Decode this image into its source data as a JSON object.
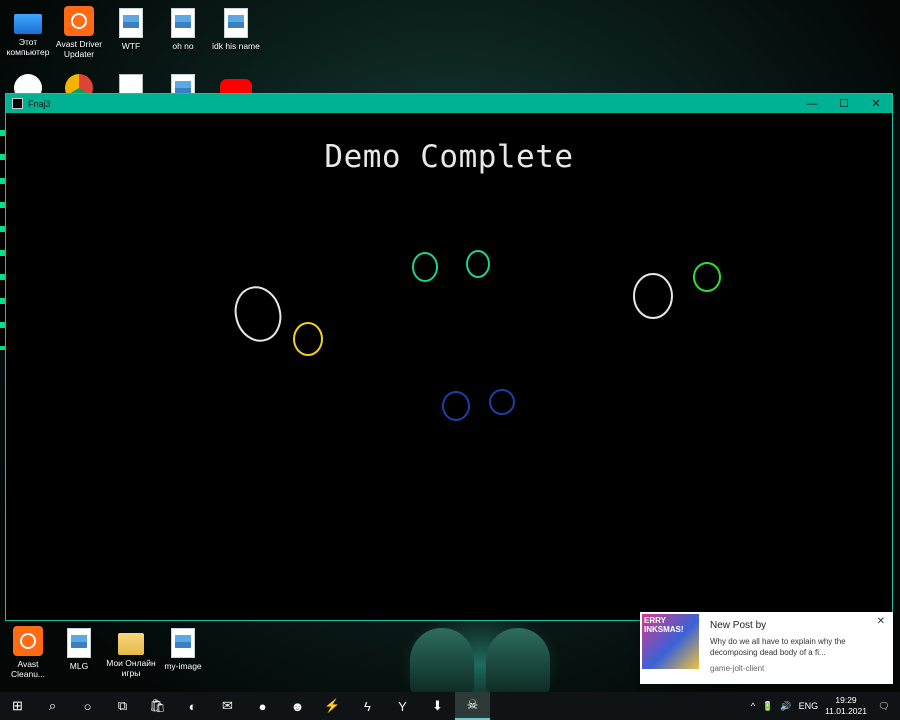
{
  "desktop": {
    "top_icons": [
      {
        "label": "Этот компьютер",
        "icon": "pc"
      },
      {
        "label": "Avast Driver Updater",
        "icon": "avast"
      },
      {
        "label": "WTF",
        "icon": "file"
      },
      {
        "label": "oh no",
        "icon": "file"
      },
      {
        "label": "idk his name",
        "icon": "file"
      }
    ],
    "bottom_icons": [
      {
        "label": "Avast Cleanu...",
        "icon": "avast"
      },
      {
        "label": "MLG",
        "icon": "file"
      },
      {
        "label": "Мои Онлайн игры",
        "icon": "folder"
      },
      {
        "label": "my-image",
        "icon": "file"
      }
    ]
  },
  "window": {
    "title": "Fnaj3",
    "minimize": "—",
    "maximize": "☐",
    "close": "✕",
    "content_title": "Demo Complete",
    "eye_colors": {
      "white": "#e6e6e6",
      "yellow": "#f2d21b",
      "teal": "#1fd18e",
      "green": "#2fe02f",
      "blue": "#1e3ea8"
    }
  },
  "toast": {
    "thumb_text": "ERRY INKSMAS!",
    "title": "New Post by",
    "body": "Why do we all have to explain why the decomposing dead body of a fi...",
    "source": "game-jolt-client",
    "close": "✕"
  },
  "taskbar": {
    "start": "⊞",
    "search": "⌕",
    "cortana": "○",
    "task_view": "⧉",
    "apps": [
      {
        "name": "store",
        "glyph": "🛍"
      },
      {
        "name": "edge",
        "glyph": "◐"
      },
      {
        "name": "mail",
        "glyph": "✉"
      },
      {
        "name": "among-us",
        "glyph": "●"
      },
      {
        "name": "game",
        "glyph": "☻"
      },
      {
        "name": "tool",
        "glyph": "⚡"
      },
      {
        "name": "game-jolt",
        "glyph": "ϟ"
      },
      {
        "name": "yandex",
        "glyph": "Y"
      },
      {
        "name": "downloader",
        "glyph": "⬇"
      },
      {
        "name": "fnaj3",
        "glyph": "☠"
      }
    ],
    "tray_chevron": "^",
    "tray_icons": [
      "🔋",
      "🔊"
    ],
    "language": "ENG",
    "time": "19:29",
    "date": "11.01.2021",
    "notification": "🗨"
  }
}
